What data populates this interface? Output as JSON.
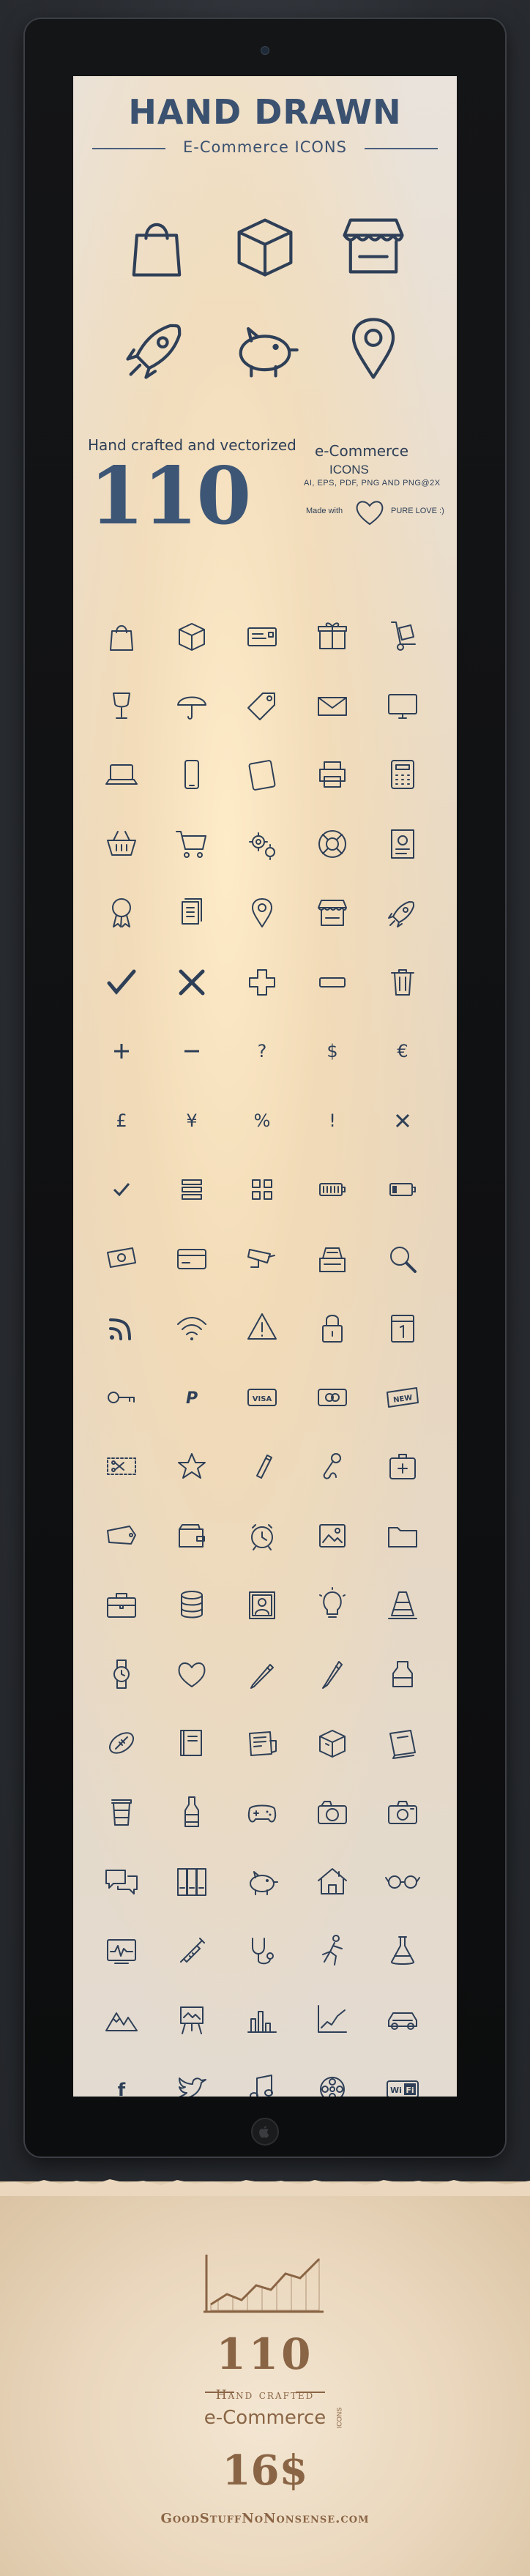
{
  "header": {
    "title": "HAND DRAWN",
    "subtitle": "E-Commerce ICONS"
  },
  "promo": {
    "hand_crafted": "Hand crafted and vectorized",
    "count": "110",
    "ecommerce": "e-Commerce",
    "icons": "ICONS",
    "formats": "AI, EPS, PDF, PNG AND PNG@2X",
    "made_with": "Made with",
    "pure_love": "PURE LOVE :)"
  },
  "hero_icons": [
    "shopping-bag",
    "package-box",
    "market-stall",
    "rocket",
    "piggy-bank",
    "map-pin"
  ],
  "icon_rows": [
    [
      "shopping-bag",
      "package-box",
      "shipping-label",
      "gift-box",
      "hand-truck"
    ],
    [
      "fragile-glass",
      "umbrella",
      "price-tag",
      "envelope",
      "monitor"
    ],
    [
      "laptop",
      "smartphone",
      "tablet",
      "printer",
      "calculator"
    ],
    [
      "shopping-basket",
      "shopping-cart",
      "gears",
      "life-buoy",
      "certificate"
    ],
    [
      "award-ribbon",
      "documents",
      "map-pin",
      "market-stall",
      "rocket"
    ],
    [
      "check-mark",
      "x-mark",
      "plus-sign",
      "minus-sign",
      "trash-can"
    ],
    [
      "plus",
      "minus",
      "question",
      "dollar",
      "euro"
    ],
    [
      "pound",
      "yen",
      "percent",
      "exclamation",
      "times"
    ],
    [
      "check",
      "list",
      "grid",
      "battery-full",
      "battery-low"
    ],
    [
      "cash",
      "credit-card",
      "security-camera",
      "cash-register",
      "magnifier"
    ],
    [
      "rss",
      "wifi",
      "warning",
      "padlock",
      "calendar"
    ],
    [
      "key",
      "paypal",
      "visa",
      "mastercard",
      "new-badge"
    ],
    [
      "coupon",
      "star",
      "usb-drive",
      "microphone",
      "first-aid"
    ],
    [
      "sale-tag",
      "wallet",
      "alarm-clock",
      "photo",
      "folder"
    ],
    [
      "briefcase",
      "database",
      "portrait",
      "light-bulb",
      "traffic-cone"
    ],
    [
      "wristwatch",
      "heart",
      "pencil",
      "pen",
      "ink-bottle"
    ],
    [
      "football",
      "book",
      "newspaper",
      "cube",
      "closed-book"
    ],
    [
      "coffee-cup",
      "bottle",
      "gamepad",
      "film-camera",
      "photo-camera"
    ],
    [
      "chat-bubbles",
      "binders",
      "piggy-bank",
      "house",
      "glasses"
    ],
    [
      "tv",
      "syringe",
      "stethoscope",
      "runner",
      "flask"
    ],
    [
      "mountains",
      "easel",
      "bar-chart",
      "line-chart",
      "car"
    ],
    [
      "facebook",
      "twitter",
      "music-note",
      "film-reel",
      "wifi-sign"
    ]
  ],
  "bottom": {
    "count": "110",
    "hand_crafted": "Hand crafted",
    "ecommerce": "e-Commerce",
    "icons_vertical": "ICONS",
    "price": "16$",
    "site": "GoodStuffNoNonsense.com"
  },
  "colors": {
    "ink": "#2e3f57",
    "title_blue": "#3b5170",
    "brown": "#8a6545"
  }
}
